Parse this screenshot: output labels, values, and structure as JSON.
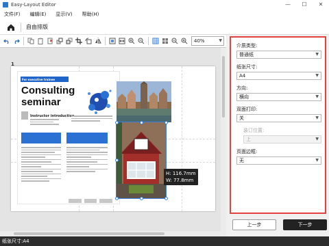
{
  "window": {
    "title": "Easy-Layout Editor",
    "minimize": "—",
    "maximize": "☐",
    "close": "✕"
  },
  "menu": [
    "文件(F)",
    "编辑(E)",
    "显示(V)",
    "帮助(H)"
  ],
  "mode": {
    "label": "自由排版"
  },
  "toolbar": {
    "zoom": "40%"
  },
  "canvas": {
    "page_number": "1",
    "brochure": {
      "tag": "For executive trainee",
      "title_line1": "Consulting",
      "title_line2": "seminar",
      "subhead": "Instructor introduction"
    },
    "selection": {
      "height": "H: 116.7mm",
      "width": "W: 77.8mm"
    }
  },
  "panel": {
    "media_type": {
      "label": "介质类型:",
      "value": "普通纸"
    },
    "paper_size": {
      "label": "纸张尺寸:",
      "value": "A4"
    },
    "orientation": {
      "label": "方向:",
      "value": "横向"
    },
    "duplex": {
      "label": "双面打印:",
      "value": "关"
    },
    "binding": {
      "label": "装订位置:",
      "value": "上"
    },
    "margin": {
      "label": "页面边框:",
      "value": "无"
    }
  },
  "buttons": {
    "prev": "上一步",
    "next": "下一步"
  },
  "status": {
    "text": "纸张尺寸:A4"
  },
  "colors": {
    "panel_border": "#e34040",
    "accent_blue": "#2b71d4",
    "selection": "#3a7fe0"
  }
}
